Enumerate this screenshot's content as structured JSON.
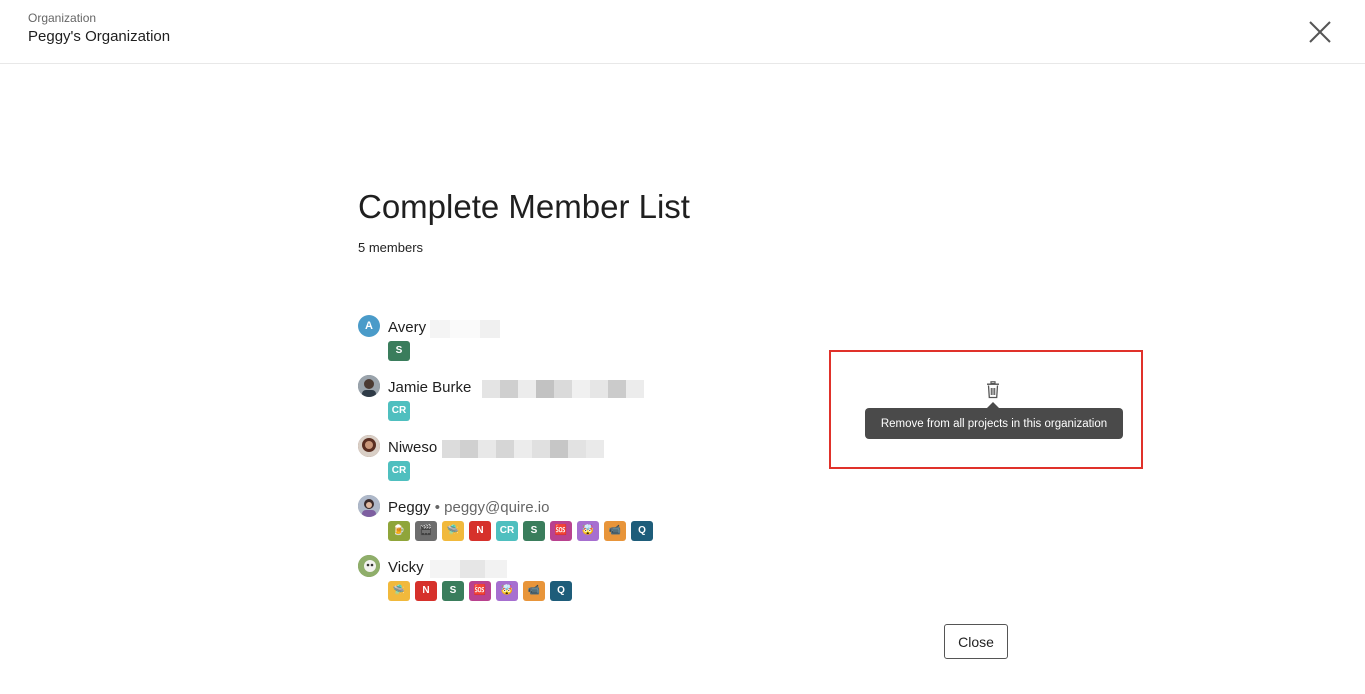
{
  "header": {
    "caption": "Organization",
    "org_name": "Peggy's Organization",
    "close_icon": "close-icon"
  },
  "main": {
    "title": "Complete Member List",
    "member_count": "5 members"
  },
  "members": [
    {
      "name": "Avery",
      "name_suffix": "",
      "email": "",
      "avatar": {
        "letter": "A",
        "color": "#4a9bc9"
      },
      "projects": [
        {
          "label": "S",
          "color": "#3a7d5c"
        }
      ]
    },
    {
      "name": "Jamie Burke",
      "name_suffix": "",
      "email": "",
      "avatar": {
        "letter": "",
        "color": "#5a6a78"
      },
      "projects": [
        {
          "label": "CR",
          "color": "#4fbfbf"
        }
      ]
    },
    {
      "name": "Niweso",
      "name_suffix": "",
      "email": "",
      "avatar": {
        "letter": "",
        "color": "#8a5a48"
      },
      "projects": [
        {
          "label": "CR",
          "color": "#4fbfbf"
        }
      ]
    },
    {
      "name": "Peggy",
      "name_suffix": " • ",
      "email": "peggy@quire.io",
      "avatar": {
        "letter": "",
        "color": "#6f7b8f"
      },
      "projects": [
        {
          "label": "🍺",
          "color": "#8fa53a"
        },
        {
          "label": "🎬",
          "color": "#6d6d6d"
        },
        {
          "label": "🛸",
          "color": "#f1b93c"
        },
        {
          "label": "N",
          "color": "#d6312b"
        },
        {
          "label": "CR",
          "color": "#4fbfbf"
        },
        {
          "label": "S",
          "color": "#3a7d5c"
        },
        {
          "label": "🆘",
          "color": "#b9428f"
        },
        {
          "label": "🤯",
          "color": "#a66fd0"
        },
        {
          "label": "📹",
          "color": "#e8953a"
        },
        {
          "label": "Q",
          "color": "#1e5d7a"
        }
      ]
    },
    {
      "name": "Vicky",
      "name_suffix": "",
      "email": "",
      "avatar": {
        "letter": "",
        "color": "#6e8d4a"
      },
      "projects": [
        {
          "label": "🛸",
          "color": "#f1b93c"
        },
        {
          "label": "N",
          "color": "#d6312b"
        },
        {
          "label": "S",
          "color": "#3a7d5c"
        },
        {
          "label": "🆘",
          "color": "#b9428f"
        },
        {
          "label": "🤯",
          "color": "#a66fd0"
        },
        {
          "label": "📹",
          "color": "#e8953a"
        },
        {
          "label": "Q",
          "color": "#1e5d7a"
        }
      ]
    }
  ],
  "row_action": {
    "icon": "trash-icon",
    "tooltip": "Remove from all projects in this organization"
  },
  "footer": {
    "close_label": "Close"
  },
  "colors": {
    "highlight": "#e0312a",
    "tooltip_bg": "#4a4a4a"
  }
}
